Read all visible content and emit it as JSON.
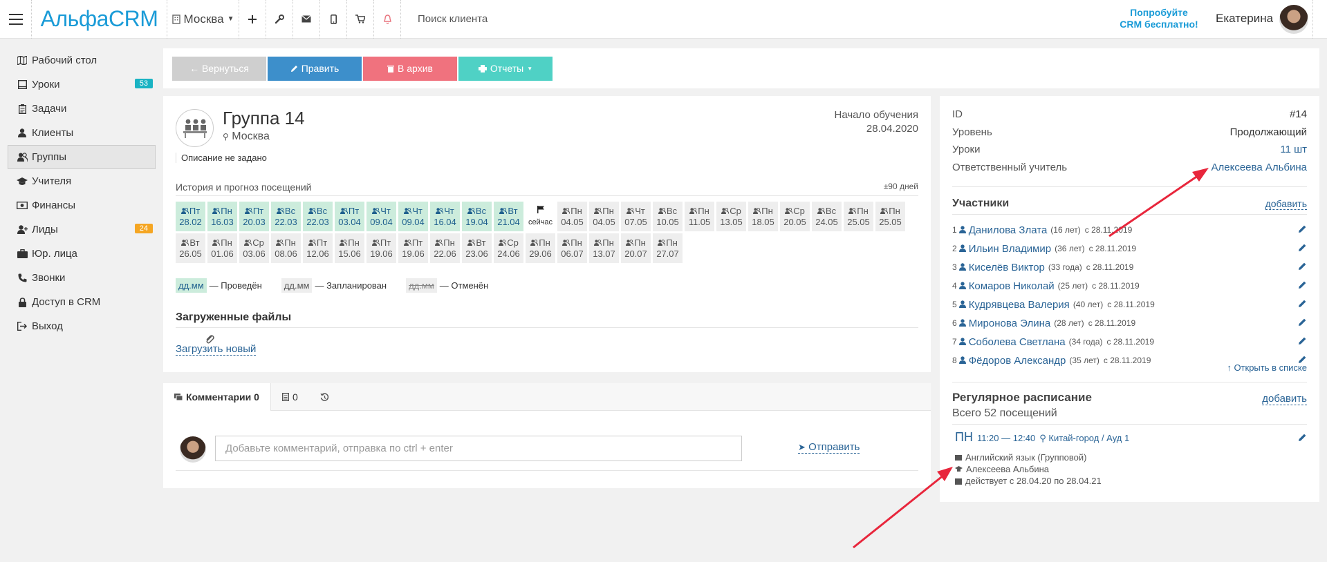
{
  "topbar": {
    "logo": "АльфаCRM",
    "branch": "Москва",
    "search_placeholder": "Поиск клиента",
    "promo_line1": "Попробуйте",
    "promo_line2": "CRM бесплатно!",
    "user_name": "Екатерина",
    "icons": [
      "plus-icon",
      "wrench-icon",
      "mail-icon",
      "mobile-icon",
      "cart-icon",
      "bell-icon"
    ]
  },
  "sidebar": {
    "items": [
      {
        "label": "Рабочий стол",
        "icon": "map-icon"
      },
      {
        "label": "Уроки",
        "icon": "book-icon",
        "badge": "53",
        "badge_color": "#1ab3c3"
      },
      {
        "label": "Задачи",
        "icon": "clipboard-icon"
      },
      {
        "label": "Клиенты",
        "icon": "user-icon"
      },
      {
        "label": "Группы",
        "icon": "users-icon",
        "active": true
      },
      {
        "label": "Учителя",
        "icon": "graduation-cap-icon"
      },
      {
        "label": "Финансы",
        "icon": "money-icon"
      },
      {
        "label": "Лиды",
        "icon": "user-plus-icon",
        "badge": "24",
        "badge_color": "#f5a623"
      },
      {
        "label": "Юр. лица",
        "icon": "briefcase-icon"
      },
      {
        "label": "Звонки",
        "icon": "phone-icon"
      },
      {
        "label": "Доступ в CRM",
        "icon": "lock-icon"
      },
      {
        "label": "Выход",
        "icon": "sign-out-icon"
      }
    ]
  },
  "toolbar": {
    "back": "← Вернуться",
    "edit": "Править",
    "archive": "В архив",
    "reports": "Отчеты",
    "colors": {
      "back": "#cfcfcf",
      "edit": "#3d8fcb",
      "archive": "#f0727e",
      "reports": "#4fd1c5"
    }
  },
  "group": {
    "title": "Группа 14",
    "location": "Москва",
    "start_label": "Начало обучения",
    "start_date": "28.04.2020",
    "description": "Описание не задано",
    "history_label": "История и прогноз посещений",
    "history_range": "±90 дней",
    "lessons": [
      {
        "day": "Пт",
        "date": "28.02",
        "status": "done"
      },
      {
        "day": "Пн",
        "date": "16.03",
        "status": "done"
      },
      {
        "day": "Пт",
        "date": "20.03",
        "status": "done"
      },
      {
        "day": "Вс",
        "date": "22.03",
        "status": "done"
      },
      {
        "day": "Вс",
        "date": "22.03",
        "status": "done"
      },
      {
        "day": "Пт",
        "date": "03.04",
        "status": "done"
      },
      {
        "day": "Чт",
        "date": "09.04",
        "status": "done"
      },
      {
        "day": "Чт",
        "date": "09.04",
        "status": "done"
      },
      {
        "day": "Чт",
        "date": "16.04",
        "status": "done"
      },
      {
        "day": "Вс",
        "date": "19.04",
        "status": "done"
      },
      {
        "day": "Вт",
        "date": "21.04",
        "status": "done"
      },
      {
        "day": "",
        "date": "сейчас",
        "status": "now"
      },
      {
        "day": "Пн",
        "date": "04.05",
        "status": "planned"
      },
      {
        "day": "Пн",
        "date": "04.05",
        "status": "planned"
      },
      {
        "day": "Чт",
        "date": "07.05",
        "status": "planned"
      },
      {
        "day": "Вс",
        "date": "10.05",
        "status": "planned"
      },
      {
        "day": "Пн",
        "date": "11.05",
        "status": "planned"
      },
      {
        "day": "Ср",
        "date": "13.05",
        "status": "planned"
      },
      {
        "day": "Пн",
        "date": "18.05",
        "status": "planned"
      },
      {
        "day": "Ср",
        "date": "20.05",
        "status": "planned"
      },
      {
        "day": "Вс",
        "date": "24.05",
        "status": "planned"
      },
      {
        "day": "Пн",
        "date": "25.05",
        "status": "planned"
      },
      {
        "day": "Пн",
        "date": "25.05",
        "status": "planned"
      },
      {
        "day": "Вт",
        "date": "26.05",
        "status": "planned"
      },
      {
        "day": "Пн",
        "date": "01.06",
        "status": "planned"
      },
      {
        "day": "Ср",
        "date": "03.06",
        "status": "planned"
      },
      {
        "day": "Пн",
        "date": "08.06",
        "status": "planned"
      },
      {
        "day": "Пт",
        "date": "12.06",
        "status": "planned"
      },
      {
        "day": "Пн",
        "date": "15.06",
        "status": "planned"
      },
      {
        "day": "Пт",
        "date": "19.06",
        "status": "planned"
      },
      {
        "day": "Пт",
        "date": "19.06",
        "status": "planned"
      },
      {
        "day": "Пн",
        "date": "22.06",
        "status": "planned"
      },
      {
        "day": "Вт",
        "date": "23.06",
        "status": "planned"
      },
      {
        "day": "Ср",
        "date": "24.06",
        "status": "planned"
      },
      {
        "day": "Пн",
        "date": "29.06",
        "status": "planned"
      },
      {
        "day": "Пн",
        "date": "06.07",
        "status": "planned"
      },
      {
        "day": "Пн",
        "date": "13.07",
        "status": "planned"
      },
      {
        "day": "Пн",
        "date": "20.07",
        "status": "planned"
      },
      {
        "day": "Пн",
        "date": "27.07",
        "status": "planned"
      }
    ],
    "legend": [
      {
        "swatch": "дд.мм",
        "label": "— Проведён",
        "status": "done"
      },
      {
        "swatch": "дд.мм",
        "label": "— Запланирован",
        "status": "planned"
      },
      {
        "swatch": "дд.мм",
        "label": "— Отменён",
        "status": "cancelled"
      }
    ],
    "files_title": "Загруженные файлы",
    "upload_label": "Загрузить новый"
  },
  "comments": {
    "tab_comments": "Комментарии 0",
    "tab_notes": "0",
    "input_placeholder": "Добавьте комментарий, отправка по ctrl + enter",
    "send_label": "Отправить"
  },
  "info": {
    "rows": [
      {
        "label": "ID",
        "value": "#14"
      },
      {
        "label": "Уровень",
        "value": "Продолжающий"
      },
      {
        "label": "Уроки",
        "value": "11 шт",
        "link": true
      },
      {
        "label": "Ответственный учитель",
        "value": "Алексеева Альбина",
        "link": true
      }
    ],
    "members_title": "Участники",
    "members_add": "добавить",
    "members": [
      {
        "num": "1",
        "name": "Данилова Злата",
        "age": "(16 лет)",
        "since": "с 28.11.2019"
      },
      {
        "num": "2",
        "name": "Ильин Владимир",
        "age": "(36 лет)",
        "since": "с 28.11.2019"
      },
      {
        "num": "3",
        "name": "Киселёв Виктор",
        "age": "(33 года)",
        "since": "с 28.11.2019"
      },
      {
        "num": "4",
        "name": "Комаров Николай",
        "age": "(25 лет)",
        "since": "с 28.11.2019"
      },
      {
        "num": "5",
        "name": "Кудрявцева Валерия",
        "age": "(40 лет)",
        "since": "с 28.11.2019"
      },
      {
        "num": "6",
        "name": "Миронова Элина",
        "age": "(28 лет)",
        "since": "с 28.11.2019"
      },
      {
        "num": "7",
        "name": "Соболева Светлана",
        "age": "(34 года)",
        "since": "с 28.11.2019"
      },
      {
        "num": "8",
        "name": "Фёдоров Александр",
        "age": "(35 лет)",
        "since": "с 28.11.2019"
      }
    ],
    "open_list": "Открыть в списке",
    "schedule_title": "Регулярное расписание",
    "schedule_add": "добавить",
    "schedule_total": "Всего 52 посещений",
    "schedule": {
      "day": "ПН",
      "time": "11:20 — 12:40",
      "location": "Китай-город / Ауд 1",
      "subject": "Английский язык (Групповой)",
      "teacher": "Алексеева Альбина",
      "period": "действует с 28.04.20 по 28.04.21"
    }
  },
  "accent_colors": {
    "brand": "#1a9bd7",
    "link": "#2a6496",
    "done": "#ccecdc",
    "arrow": "#e8263c"
  }
}
